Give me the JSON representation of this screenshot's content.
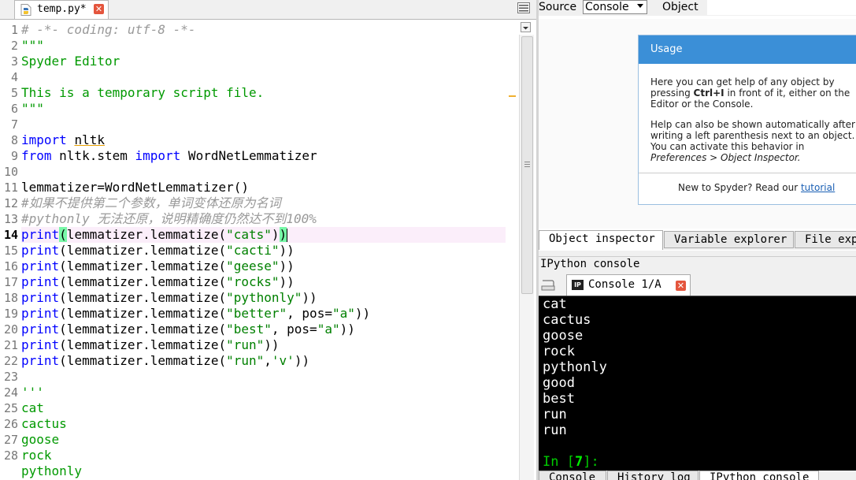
{
  "editor": {
    "tab_label": "temp.py*",
    "current_line": 14,
    "line_numbers": [
      "1",
      "2",
      "3",
      "4",
      "5",
      "6",
      "7",
      "8",
      "9",
      "10",
      "11",
      "12",
      "13",
      "14",
      "15",
      "16",
      "17",
      "18",
      "19",
      "20",
      "21",
      "22",
      "23",
      "24",
      "25",
      "26",
      "27",
      "28"
    ],
    "lines": {
      "l1": "# -*- coding: utf-8 -*-",
      "l2": "\"\"\"",
      "l3": "Spyder Editor",
      "l5": "This is a temporary script file.",
      "l6": "\"\"\"",
      "l8_kw": "import",
      "l8_mod": "nltk",
      "l9_kw1": "from",
      "l9_mod": " nltk.stem ",
      "l9_kw2": "import",
      "l9_name": " WordNetLemmatizer",
      "l11": "lemmatizer=WordNetLemmatizer()",
      "l12": "#如果不提供第二个参数，单词变体还原为名词",
      "l13": "#pythonly 无法还原，说明精确度仍然达不到100%",
      "print_kw": "print",
      "call_prefix": "(lemmatizer.lemmatize(",
      "l14_arg": "\"cats\"",
      "l15_arg": "\"cacti\"",
      "l16_arg": "\"geese\"",
      "l17_arg": "\"rocks\"",
      "l18_arg": "\"pythonly\"",
      "l19_arg": "\"better\"",
      "l19_kw": ", pos=",
      "l19_pos": "\"a\"",
      "l20_arg": "\"best\"",
      "l20_kw": ", pos=",
      "l20_pos": "\"a\"",
      "l21_arg": "\"run\"",
      "l22_arg": "\"run\"",
      "l22_sep": ",",
      "l22_pos": "'v'",
      "close2": "))",
      "l24": "'''",
      "l25": "cat",
      "l26": "cactus",
      "l27": "goose",
      "l28": "rock",
      "l29": "pythonly"
    }
  },
  "inspector": {
    "source_label": "Source",
    "source_value": "Console",
    "object_label": "Object",
    "object_value": "",
    "usage": {
      "title": "Usage",
      "p1_line1": "Here you can get help of any object by",
      "p1_line2_pre": "pressing ",
      "p1_line2_key": "Ctrl+I",
      "p1_line2_post": " in front of it, either on the",
      "p1_line3": "Editor or the Console.",
      "p2_line1": "Help can also be shown automatically after",
      "p2_line2": "writing a left parenthesis next to an object.",
      "p2_line3": "You can activate this behavior in",
      "p2_line4": "Preferences > Object Inspector.",
      "footer_text": "New to Spyder? Read our ",
      "footer_link": "tutorial"
    },
    "tabs": [
      "Object inspector",
      "Variable explorer",
      "File explorer"
    ]
  },
  "ipython": {
    "pane_title": "IPython console",
    "console_tab_label": "Console 1/A",
    "output_lines": [
      "cat",
      "cactus",
      "goose",
      "rock",
      "pythonly",
      "good",
      "best",
      "run",
      "run"
    ],
    "prompt_prefix": "In [",
    "prompt_number": "7",
    "prompt_suffix": "]:",
    "bottom_tabs": [
      "Console",
      "History log",
      "IPython console"
    ]
  },
  "colors": {
    "keyword": "#0000ff",
    "string": "#008000",
    "comment": "#999999",
    "usage_header": "#3b8fd7",
    "console_bg": "#000000",
    "prompt": "#00cc00"
  },
  "icons": {
    "editor_tab": "python-file-icon",
    "tab_close": "close-icon",
    "editor_options": "options-icon",
    "inspector_pane": "pane-menu-icon",
    "console_tab": "ipython-icon"
  }
}
